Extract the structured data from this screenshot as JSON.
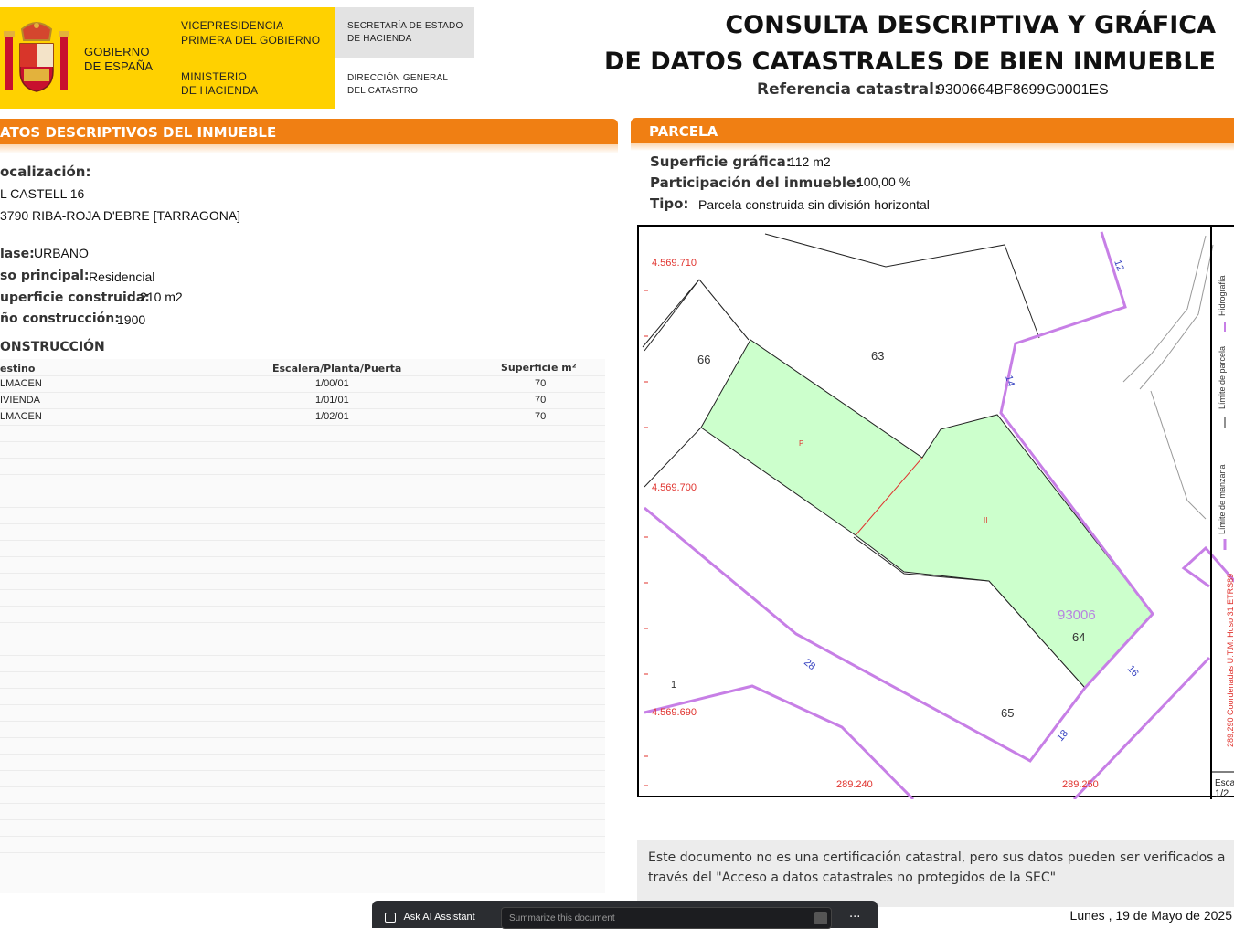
{
  "header": {
    "gov_line1": "GOBIERNO",
    "gov_line2": "DE ESPAÑA",
    "vice_line1": "VICEPRESIDENCIA",
    "vice_line2": "PRIMERA DEL GOBIERNO",
    "min_line1": "MINISTERIO",
    "min_line2": "DE HACIENDA",
    "sec_line1": "SECRETARÍA DE ESTADO",
    "sec_line2": "DE HACIENDA",
    "dir_line1": "DIRECCIÓN GENERAL",
    "dir_line2": "DEL CATASTRO",
    "title_line1": "CONSULTA DESCRIPTIVA Y GRÁFICA",
    "title_line2": "DE DATOS CATASTRALES DE BIEN INMUEBLE",
    "ref_label": "Referencia catastral:",
    "ref_value": "9300664BF8699G0001ES"
  },
  "left": {
    "section_title": "ATOS DESCRIPTIVOS DEL INMUEBLE",
    "loc_label": "ocalización:",
    "loc_line1": "L CASTELL 16",
    "loc_line2": "3790 RIBA-ROJA D'EBRE [TARRAGONA]",
    "clase_label": "lase:",
    "clase_value": "URBANO",
    "uso_label": "so principal:",
    "uso_value": "Residencial",
    "sup_label": "uperficie construida:",
    "sup_value": "210 m2",
    "anio_label": "ño construcción:",
    "anio_value": "1900",
    "construccion_title": "ONSTRUCCIÓN",
    "table": {
      "headers": [
        "estino",
        "Escalera/Planta/Puerta",
        "Superficie m²"
      ],
      "rows": [
        [
          "LMACEN",
          "1/00/01",
          "70"
        ],
        [
          "IVIENDA",
          "1/01/01",
          "70"
        ],
        [
          "LMACEN",
          "1/02/01",
          "70"
        ]
      ]
    }
  },
  "right": {
    "section_title": "PARCELA",
    "supgraf_label": "Superficie gráfica:",
    "supgraf_value": "112 m2",
    "part_label": "Participación del inmueble:",
    "part_value": "100,00 %",
    "tipo_label": "Tipo:",
    "tipo_value": "Parcela construida sin división horizontal"
  },
  "map": {
    "coord_y1": "4.569.710",
    "coord_y2": "4.569.700",
    "coord_y3": "4.569.690",
    "coord_x1": "289.240",
    "coord_x2": "289.250",
    "parcel_66": "66",
    "parcel_63": "63",
    "parcel_64": "64",
    "parcel_65": "65",
    "parcel_1": "1",
    "block_93006": "93006",
    "mark_p": "P",
    "mark_ii": "II",
    "street_12": "12",
    "street_14": "14",
    "street_16": "16",
    "street_18": "18",
    "street_28": "28",
    "legend_hidro": "Hidrografía",
    "legend_parcela": "Límite de parcela",
    "legend_manzana": "Límite de manzana",
    "legend_coord": "289,290 Coordenadas U.T.M. Huso 31 ETRS89",
    "scale_label": "Esca",
    "scale_value": "1/2",
    "colors": {
      "parcel_fill": "#ccffcc",
      "block_line": "#c77fe6",
      "coord_red": "#e0332e",
      "block_label": "#b784e0"
    }
  },
  "footer": {
    "notice": "Este documento no es una certificación catastral, pero sus datos pueden ser verificados a través del \"Acceso a datos catastrales no protegidos de la SEC\"",
    "date": "Lunes , 19 de Mayo de 2025",
    "ai_button": "Ask AI Assistant",
    "ai_placeholder": "Summarize this document",
    "more": "···"
  }
}
